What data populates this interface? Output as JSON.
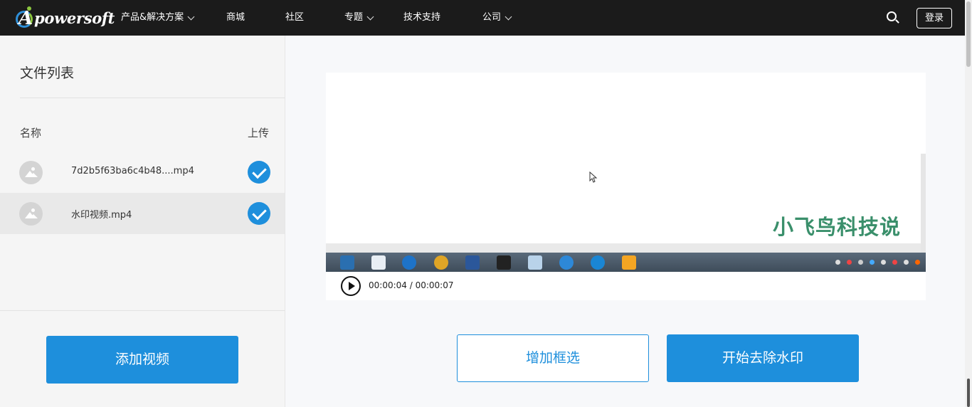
{
  "header": {
    "logo_text": "powersoft",
    "logo_letter": "A",
    "nav": [
      {
        "label": "产品&解决方案",
        "has_dropdown": true
      },
      {
        "label": "商城",
        "has_dropdown": false
      },
      {
        "label": "社区",
        "has_dropdown": false
      },
      {
        "label": "专题",
        "has_dropdown": true
      },
      {
        "label": "技术支持",
        "has_dropdown": false
      },
      {
        "label": "公司",
        "has_dropdown": true
      }
    ],
    "search_icon": "search-icon",
    "login_label": "登录"
  },
  "sidebar": {
    "title": "文件列表",
    "col_name": "名称",
    "col_upload": "上传",
    "files": [
      {
        "name": "7d2b5f63ba6c4b48....mp4",
        "uploaded": true,
        "selected": false
      },
      {
        "name": "水印视频.mp4",
        "uploaded": true,
        "selected": true
      }
    ],
    "add_button": "添加视频"
  },
  "player": {
    "watermark_text": "小飞鸟科技说",
    "timecode": "00:00:04 / 00:00:07"
  },
  "actions": {
    "add_selection": "增加框选",
    "start_remove": "开始去除水印"
  },
  "colors": {
    "accent": "#1e8fdc",
    "header_bg": "#1b1b1b",
    "watermark": "#3a8f6b"
  }
}
